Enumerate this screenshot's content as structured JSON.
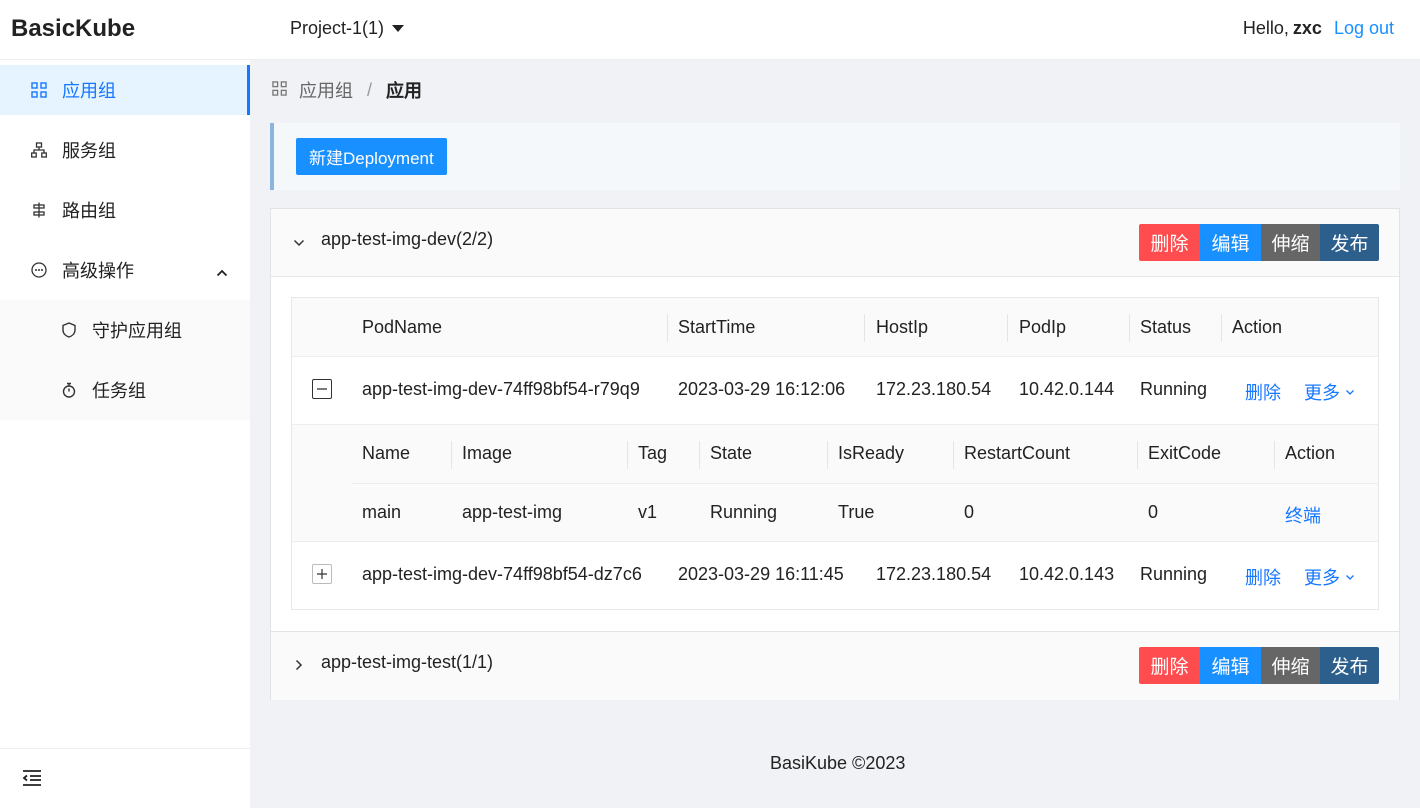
{
  "header": {
    "logo": "BasicKube",
    "project": "Project-1(1)",
    "hello": "Hello,",
    "user": "zxc",
    "logout": "Log out"
  },
  "sidebar": {
    "items": [
      {
        "label": "应用组",
        "icon": "appstore-icon"
      },
      {
        "label": "服务组",
        "icon": "cluster-icon"
      },
      {
        "label": "路由组",
        "icon": "route-icon"
      },
      {
        "label": "高级操作",
        "icon": "ellipsis-icon"
      },
      {
        "label": "守护应用组",
        "icon": "shield-icon"
      },
      {
        "label": "任务组",
        "icon": "timer-icon"
      }
    ]
  },
  "breadcrumb": {
    "parent": "应用组",
    "sep": "/",
    "current": "应用"
  },
  "toolbar": {
    "new_button": "新建Deployment"
  },
  "actions": {
    "delete": "删除",
    "edit": "编辑",
    "scale": "伸缩",
    "publish": "发布"
  },
  "deployments": [
    {
      "name": "app-test-img-dev(2/2)",
      "expanded": true
    },
    {
      "name": "app-test-img-test(1/1)",
      "expanded": false
    }
  ],
  "pod_table": {
    "columns": [
      "PodName",
      "StartTime",
      "HostIp",
      "PodIp",
      "Status",
      "Action"
    ],
    "rows": [
      {
        "name": "app-test-img-dev-74ff98bf54-r79q9",
        "start": "2023-03-29 16:12:06",
        "host": "172.23.180.54",
        "podip": "10.42.0.144",
        "status": "Running",
        "del": "删除",
        "more": "更多"
      },
      {
        "name": "app-test-img-dev-74ff98bf54-dz7c6",
        "start": "2023-03-29 16:11:45",
        "host": "172.23.180.54",
        "podip": "10.42.0.143",
        "status": "Running",
        "del": "删除",
        "more": "更多"
      }
    ]
  },
  "container_table": {
    "columns": [
      "Name",
      "Image",
      "Tag",
      "State",
      "IsReady",
      "RestartCount",
      "ExitCode",
      "Action"
    ],
    "rows": [
      {
        "name": "main",
        "image": "app-test-img",
        "tag": "v1",
        "state": "Running",
        "ready": "True",
        "restart": "0",
        "exit": "0",
        "action": "终端"
      }
    ]
  },
  "footer": "BasiKube ©2023"
}
